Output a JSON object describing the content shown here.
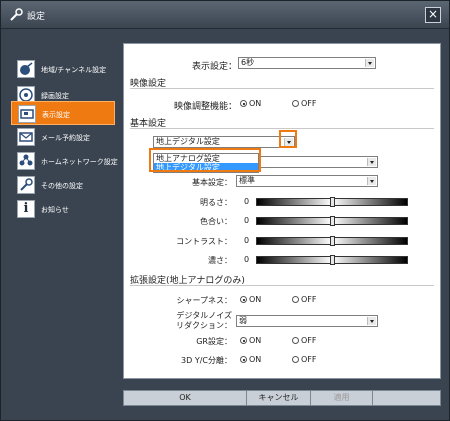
{
  "window": {
    "title": "設定",
    "close_label": "×"
  },
  "sidebar": {
    "items": [
      {
        "label": "地域/チャンネル設定",
        "icon": "satellite-dish-icon"
      },
      {
        "label": "録画設定",
        "icon": "record-icon"
      },
      {
        "label": "表示設定",
        "icon": "monitor-icon",
        "active": true
      },
      {
        "label": "メール予約設定",
        "icon": "mail-icon"
      },
      {
        "label": "ホームネットワーク設定",
        "icon": "network-icon"
      },
      {
        "label": "その他の設定",
        "icon": "wrench-icon"
      },
      {
        "label": "お知らせ",
        "icon": "info-icon"
      }
    ]
  },
  "panel": {
    "display_setting": {
      "label": "表示設定：",
      "value": "6秒"
    },
    "video": {
      "section": "映像設定",
      "adjust_label": "映像調整機能：",
      "on": "ON",
      "off": "OFF",
      "selected": "ON"
    },
    "basic": {
      "section": "基本設定",
      "source_value": "地上デジタル設定",
      "dropdown_options": [
        "地上アナログ設定",
        "地上デジタル設定"
      ],
      "dropdown_selected": "地上デジタル設定",
      "basic_label": "基本設定：",
      "basic_value": "標準",
      "sliders": [
        {
          "label": "明るさ：",
          "value": "0"
        },
        {
          "label": "色合い：",
          "value": "0"
        },
        {
          "label": "コントラスト：",
          "value": "0"
        },
        {
          "label": "濃さ：",
          "value": "0"
        }
      ]
    },
    "extended": {
      "section": "拡張設定(地上アナログのみ)",
      "sharpness_label": "シャープネス：",
      "noise_label_1": "デジタルノイズ",
      "noise_label_2": "リダクション：",
      "noise_value": "弱",
      "gr_label": "GR設定：",
      "yc_label": "3D Y/C分離：",
      "on": "ON",
      "off": "OFF"
    }
  },
  "buttons": {
    "ok": "OK",
    "cancel": "キャンセル",
    "apply": "適用"
  },
  "colors": {
    "accent": "#f07a12",
    "background": "#3a4450",
    "selection": "#3399ff"
  }
}
